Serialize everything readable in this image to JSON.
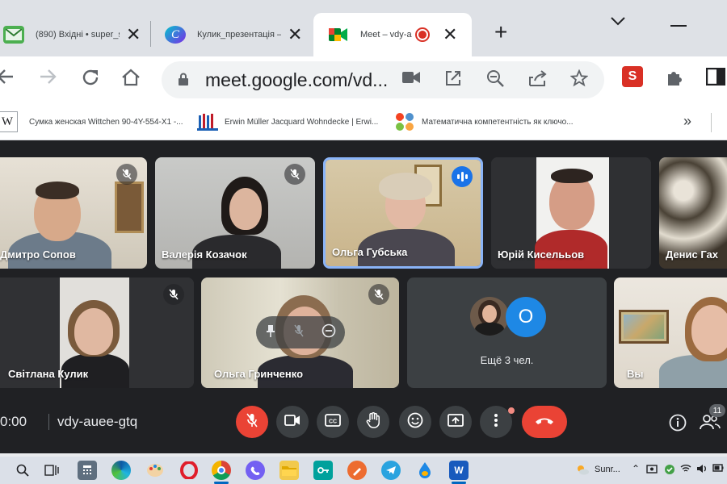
{
  "tabs": [
    {
      "title": "(890) Вхідні • super_su",
      "active": false
    },
    {
      "title": "Кулик_презентація —",
      "active": false
    },
    {
      "title": "Meet – vdy-au",
      "active": true
    }
  ],
  "address": {
    "url": "meet.google.com/vd..."
  },
  "bookmarks": [
    {
      "icon": "W",
      "label": "Сумка женская Wittchen 90-4Y-554-X1 -..."
    },
    {
      "icon": "",
      "label": "Erwin Müller Jacquard Wohndecke | Erwi..."
    },
    {
      "icon": "",
      "label": "Математична компетентність як ключо..."
    }
  ],
  "participants": [
    {
      "name": "Дмитро Сопов",
      "muted": true
    },
    {
      "name": "Валерія Козачок",
      "muted": true
    },
    {
      "name": "Ольга Губська",
      "muted": false,
      "speaking": true
    },
    {
      "name": "Юрій Киселььов",
      "muted": false
    },
    {
      "name": "Денис Гах",
      "muted": false
    },
    {
      "name": "Світлана Кулик",
      "muted": true
    },
    {
      "name": "Ольга Гринченко",
      "muted": true
    },
    {
      "name": "Вы",
      "muted": false
    }
  ],
  "others": {
    "avatar_letter": "O",
    "label": "Ещё 3 чел."
  },
  "meeting": {
    "time": "0:00",
    "code": "vdy-auee-gtq",
    "participant_count": "11"
  },
  "taskbar": {
    "weather_label": "Sunr..."
  },
  "colors": {
    "accent": "#1a73e8",
    "danger": "#ea4335",
    "speaking_border": "#8ab4f8",
    "background": "#202124"
  }
}
